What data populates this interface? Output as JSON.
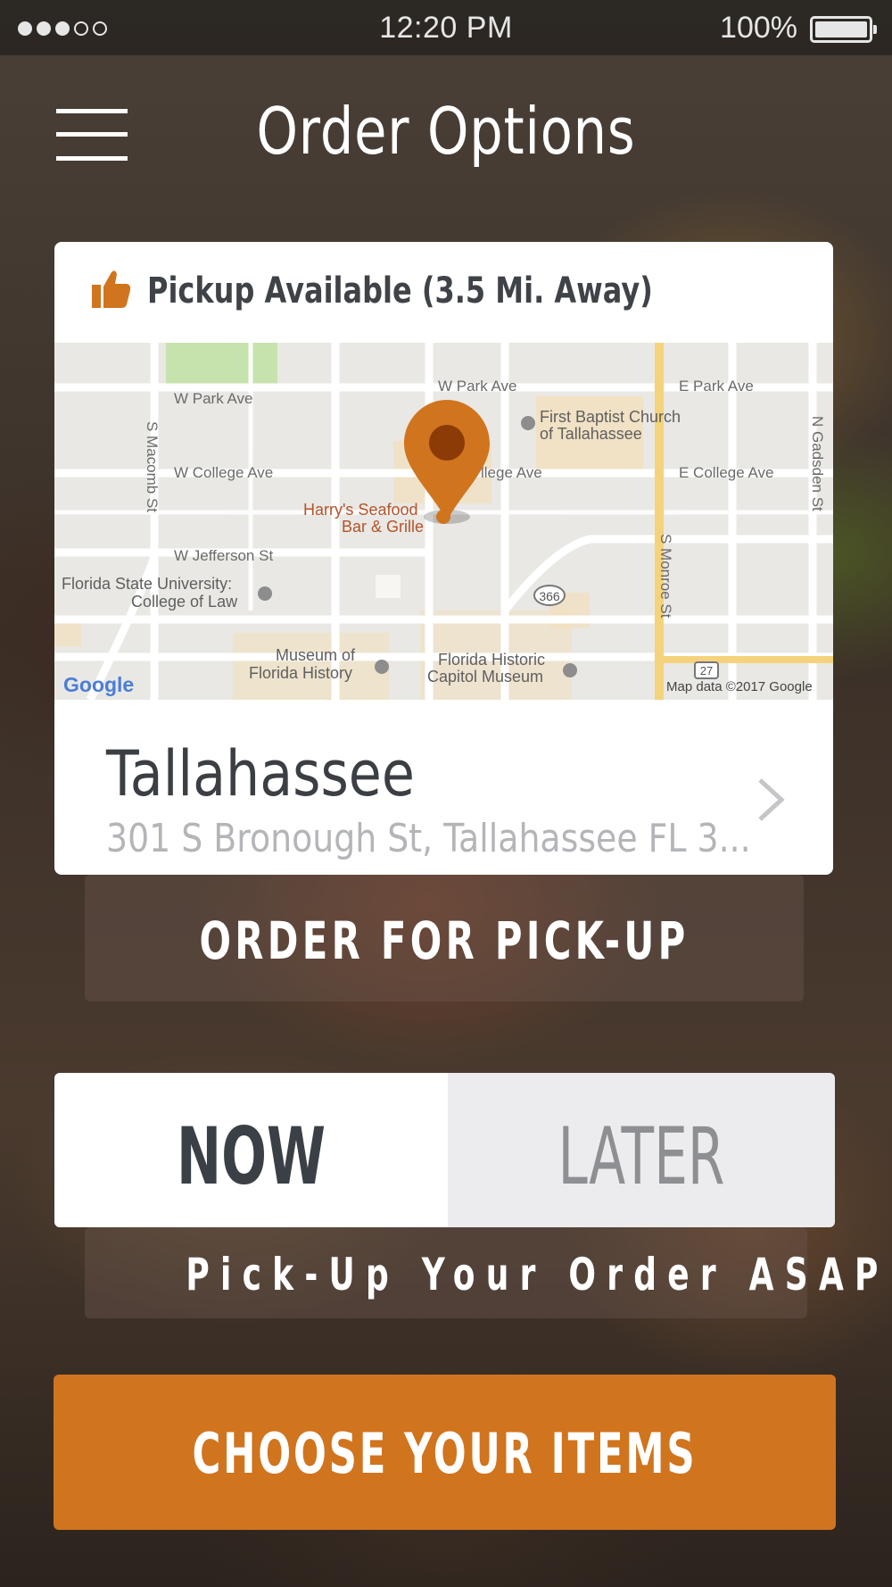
{
  "status_bar": {
    "time": "12:20 PM",
    "battery": "100%",
    "signal_icon": "signal-dots-icon",
    "battery_icon": "battery-icon"
  },
  "header": {
    "title": "Order Options",
    "menu_icon": "hamburger-menu-icon"
  },
  "pickup_card": {
    "availability": "Pickup Available (3.5 Mi. Away)",
    "availability_icon": "thumbs-up-icon",
    "map": {
      "streets": {
        "w_park_ave": "W Park Ave",
        "w_park_ave_2": "W Park Ave",
        "e_park_ave": "E Park Ave",
        "w_college_ave": "W College Ave",
        "college_ave_partial": "llege Ave",
        "e_college_ave": "E College Ave",
        "w_jefferson_st": "W Jefferson St",
        "s_macomb_st": "S Macomb St",
        "s_monroe_st": "S Monroe St",
        "n_gadsden_st": "N Gadsden St"
      },
      "places": {
        "first_baptist_1": "First Baptist Church",
        "first_baptist_2": "of Tallahassee",
        "harrys_1": "Harry's Seafood",
        "harrys_2": "Bar & Grille",
        "fsu_1": "Florida State University:",
        "fsu_2": "College of Law",
        "museum_1": "Museum of",
        "museum_2": "Florida History",
        "capitol_1": "Florida Historic",
        "capitol_2": "Capitol Museum"
      },
      "route_shield_366": "366",
      "route_shield_27": "27",
      "attribution": "Map data ©2017 Google",
      "google_logo": "Google",
      "pin_icon": "location-pin-icon"
    },
    "location_name": "Tallahassee",
    "location_address": "301 S Bronough St, Tallahassee FL 3...",
    "chevron_icon": "chevron-right-icon"
  },
  "order_type_label": "ORDER FOR PICK-UP",
  "timing": {
    "now_label": "NOW",
    "later_label": "LATER",
    "selected": "NOW"
  },
  "timing_caption": "Pick-Up Your Order ASAP",
  "cta_label": "CHOOSE YOUR ITEMS",
  "colors": {
    "accent": "#d0741e",
    "card": "#ffffff",
    "text_dark": "#3b3f44",
    "text_muted": "#b3b5b8"
  }
}
